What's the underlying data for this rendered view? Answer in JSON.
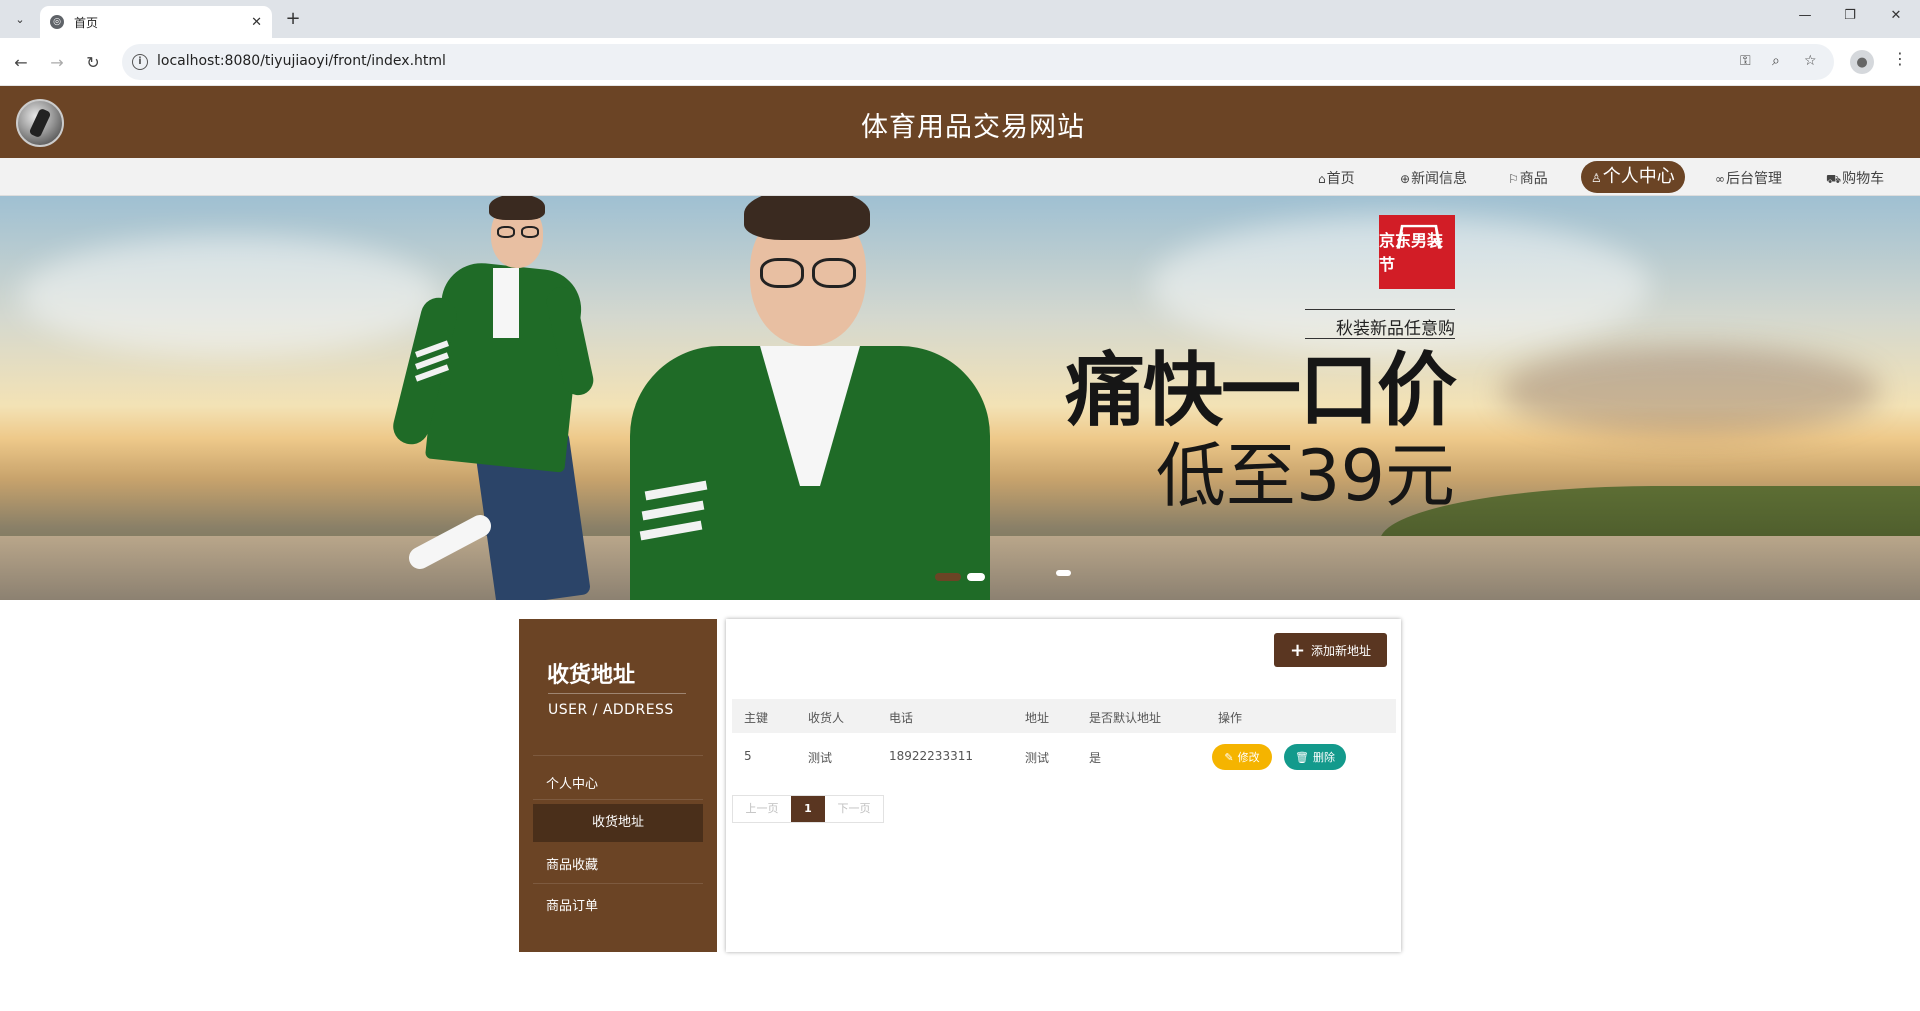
{
  "browser": {
    "tab_title": "首页",
    "url": "localhost:8080/tiyujiaoyi/front/index.html"
  },
  "site": {
    "title": "体育用品交易网站"
  },
  "nav": {
    "items": [
      {
        "icon": "home-icon",
        "label": "首页"
      },
      {
        "icon": "globe-icon",
        "label": "新闻信息"
      },
      {
        "icon": "flag-icon",
        "label": "商品"
      },
      {
        "icon": "user-icon",
        "label": "个人中心",
        "active": true
      },
      {
        "icon": "link-icon",
        "label": "后台管理"
      },
      {
        "icon": "cart-icon",
        "label": "购物车"
      }
    ]
  },
  "banner": {
    "brand": "京东男装节",
    "tagline": "秋装新品任意购",
    "headline": "痛快一口价",
    "subline": "低至39元"
  },
  "sidebar": {
    "title": "收货地址",
    "subtitle": "USER / ADDRESS",
    "items": [
      {
        "label": "个人中心"
      },
      {
        "label": "收货地址",
        "active": true
      },
      {
        "label": "商品收藏"
      },
      {
        "label": "商品订单"
      }
    ]
  },
  "content": {
    "add_button": "添加新地址",
    "columns": [
      "主键",
      "收货人",
      "电话",
      "地址",
      "是否默认地址",
      "操作"
    ],
    "rows": [
      {
        "id": "5",
        "receiver": "测试",
        "phone": "18922233311",
        "address": "测试",
        "is_default": "是"
      }
    ],
    "actions": {
      "edit": "修改",
      "delete": "删除"
    },
    "pagination": {
      "prev": "上一页",
      "current": "1",
      "next": "下一页"
    }
  },
  "colors": {
    "brand_brown": "#6b4425",
    "dark_brown": "#5a3621",
    "edit_yellow": "#f5b400",
    "delete_teal": "#139a8c"
  }
}
